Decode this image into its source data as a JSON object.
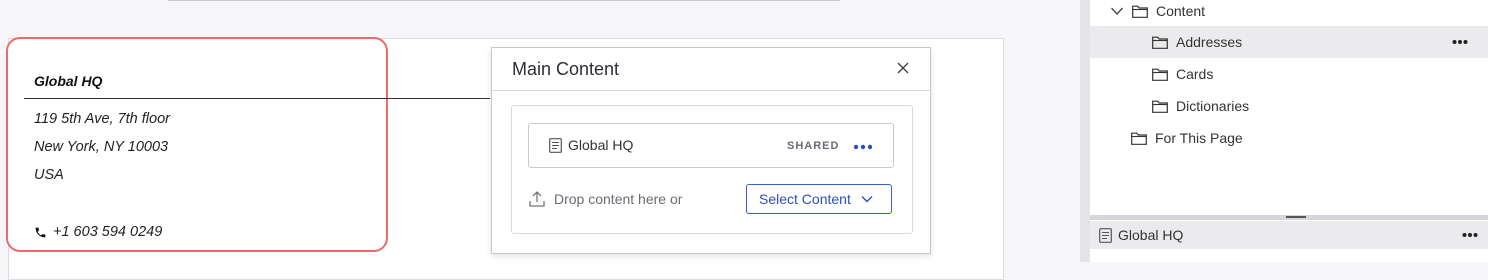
{
  "address_card": {
    "title": "Global HQ",
    "lines": [
      "119 5th Ave, 7th floor",
      "New York, NY 10003",
      "USA"
    ],
    "phone": "+1 603 594 0249"
  },
  "dialog": {
    "title": "Main Content",
    "item": {
      "name": "Global HQ",
      "badge": "SHARED"
    },
    "drop_text": "Drop content here or",
    "select_label": "Select Content"
  },
  "tree": {
    "items": [
      {
        "label": "Content",
        "expanded": true
      },
      {
        "label": "Addresses",
        "selected": true
      },
      {
        "label": "Cards"
      },
      {
        "label": "Dictionaries"
      },
      {
        "label": "For This Page"
      }
    ]
  },
  "bottom_panel": {
    "item": "Global HQ"
  },
  "colors": {
    "accent": "#2c4fbf",
    "highlight_border": "#e96b6b",
    "selected_row": "#ebebee"
  },
  "icons": [
    "chevron-down-icon",
    "folder-icon",
    "document-icon",
    "more-icon",
    "close-icon",
    "upload-icon",
    "phone-icon"
  ]
}
